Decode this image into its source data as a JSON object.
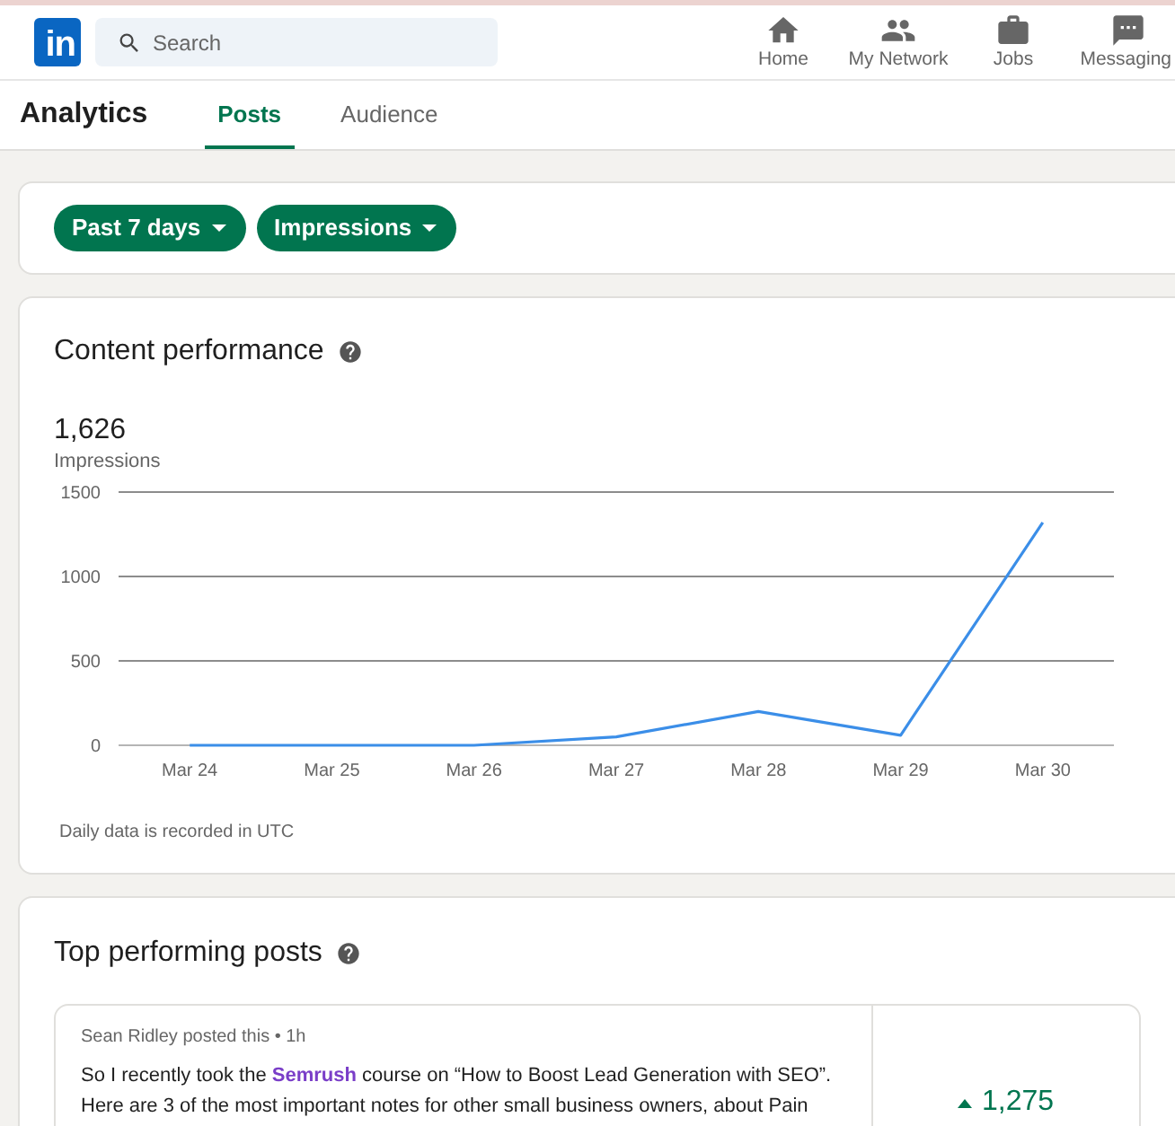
{
  "header": {
    "logo": "in",
    "search": {
      "placeholder": "Search"
    },
    "nav": [
      {
        "label": "Home"
      },
      {
        "label": "My Network"
      },
      {
        "label": "Jobs"
      },
      {
        "label": "Messaging"
      }
    ]
  },
  "subnav": {
    "title": "Analytics",
    "tabs": [
      {
        "label": "Posts",
        "selected": true
      },
      {
        "label": "Audience",
        "selected": false
      }
    ]
  },
  "filters": [
    {
      "label": "Past 7 days"
    },
    {
      "label": "Impressions"
    }
  ],
  "content_performance": {
    "title": "Content performance",
    "total": "1,626",
    "total_label": "Impressions",
    "chart_data": {
      "type": "line",
      "categories": [
        "Mar 24",
        "Mar 25",
        "Mar 26",
        "Mar 27",
        "Mar 28",
        "Mar 29",
        "Mar 30"
      ],
      "series": [
        {
          "color": "#3b8ee8",
          "values": [
            0,
            0,
            0,
            50,
            200,
            60,
            1320
          ]
        }
      ],
      "ylim": [
        0,
        1500
      ],
      "yticks": [
        0,
        500,
        1000,
        1500
      ]
    },
    "note": "Daily data is recorded in UTC"
  },
  "top_posts": {
    "title": "Top performing posts",
    "posts": [
      {
        "byline": "Sean Ridley posted this • 1h",
        "text_before": "So I recently took the ",
        "mention": "Semrush",
        "text_after": " course on “How to Boost Lead Generation with SEO”. Here are 3 of the most important notes for other small business owners, about Pain",
        "metric": "1,275"
      }
    ]
  }
}
